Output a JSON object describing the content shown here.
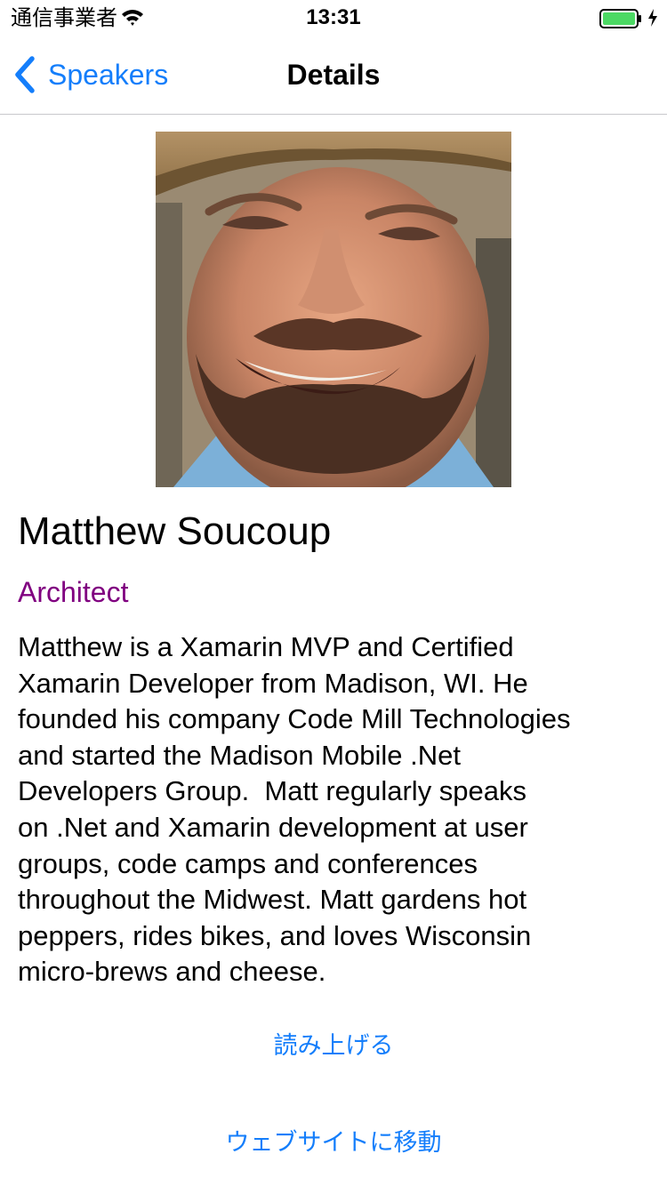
{
  "status_bar": {
    "carrier": "通信事業者",
    "time": "13:31",
    "icons": [
      "wifi-icon",
      "battery-icon",
      "charging-icon"
    ],
    "battery_color": "#4cd964"
  },
  "nav": {
    "back_label": "Speakers",
    "title": "Details",
    "back_icon": "chevron-left-icon",
    "accent_color": "#147efb"
  },
  "speaker": {
    "name": "Matthew Soucoup",
    "title": "Architect",
    "title_color": "#800080",
    "bio": "Matthew is a Xamarin MVP and Certified\nXamarin Developer from Madison, WI. He\nfounded his company Code Mill Technologies\nand started the Madison Mobile .Net\nDevelopers Group.  Matt regularly speaks\non .Net and Xamarin development at user\ngroups, code camps and conferences\nthroughout the Midwest. Matt gardens hot\npeppers, rides bikes, and loves Wisconsin\nmicro-brews and cheese."
  },
  "actions": {
    "speak_label": "読み上げる",
    "website_label": "ウェブサイトに移動"
  }
}
